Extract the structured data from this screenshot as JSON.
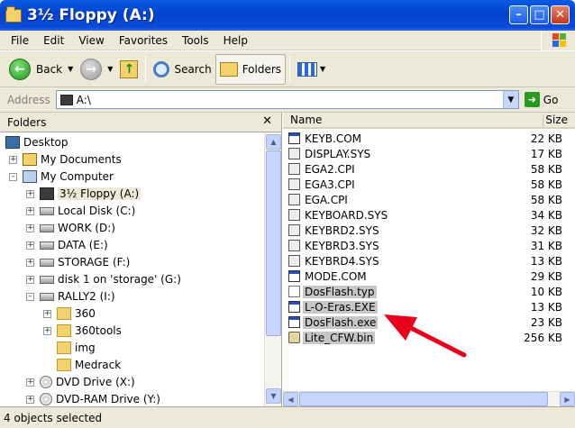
{
  "window": {
    "title": "3½ Floppy (A:)"
  },
  "menu": {
    "items": [
      "File",
      "Edit",
      "View",
      "Favorites",
      "Tools",
      "Help"
    ]
  },
  "toolbar": {
    "back_label": "Back",
    "search_label": "Search",
    "folders_label": "Folders"
  },
  "address": {
    "label": "Address",
    "value": "A:\\",
    "go_label": "Go"
  },
  "folders_pane": {
    "header": "Folders",
    "tree": [
      {
        "label": "Desktop",
        "icon": "desktop-icon"
      },
      {
        "label": "My Documents",
        "icon": "folder-icon"
      },
      {
        "label": "My Computer",
        "icon": "computer-icon"
      },
      {
        "label": "3½ Floppy (A:)",
        "icon": "floppy-icon"
      },
      {
        "label": "Local Disk (C:)",
        "icon": "drive-icon"
      },
      {
        "label": "WORK (D:)",
        "icon": "drive-icon"
      },
      {
        "label": "DATA (E:)",
        "icon": "drive-icon"
      },
      {
        "label": "STORAGE (F:)",
        "icon": "drive-icon"
      },
      {
        "label": "disk 1 on 'storage' (G:)",
        "icon": "network-drive-icon"
      },
      {
        "label": "RALLY2 (I:)",
        "icon": "drive-icon"
      },
      {
        "label": "360",
        "icon": "folder-icon"
      },
      {
        "label": "360tools",
        "icon": "folder-icon"
      },
      {
        "label": "img",
        "icon": "folder-icon"
      },
      {
        "label": "Medrack",
        "icon": "folder-icon"
      },
      {
        "label": "DVD Drive (X:)",
        "icon": "cd-icon"
      },
      {
        "label": "DVD-RAM Drive (Y:)",
        "icon": "cd-icon"
      }
    ]
  },
  "files": {
    "columns": {
      "name": "Name",
      "size": "Size"
    },
    "rows": [
      {
        "name": "KEYB.COM",
        "size": "22 KB",
        "type": "com"
      },
      {
        "name": "DISPLAY.SYS",
        "size": "17 KB",
        "type": "sys"
      },
      {
        "name": "EGA2.CPI",
        "size": "58 KB",
        "type": "cpi"
      },
      {
        "name": "EGA3.CPI",
        "size": "58 KB",
        "type": "cpi"
      },
      {
        "name": "EGA.CPI",
        "size": "58 KB",
        "type": "cpi"
      },
      {
        "name": "KEYBOARD.SYS",
        "size": "34 KB",
        "type": "sys"
      },
      {
        "name": "KEYBRD2.SYS",
        "size": "32 KB",
        "type": "sys"
      },
      {
        "name": "KEYBRD3.SYS",
        "size": "31 KB",
        "type": "sys"
      },
      {
        "name": "KEYBRD4.SYS",
        "size": "13 KB",
        "type": "sys"
      },
      {
        "name": "MODE.COM",
        "size": "29 KB",
        "type": "com"
      },
      {
        "name": "DosFlash.typ",
        "size": "10 KB",
        "type": "typ"
      },
      {
        "name": "L-O-Eras.EXE",
        "size": "13 KB",
        "type": "exe"
      },
      {
        "name": "DosFlash.exe",
        "size": "23 KB",
        "type": "exe"
      },
      {
        "name": "Lite_CFW.bin",
        "size": "256 KB",
        "type": "bin"
      }
    ]
  },
  "status": {
    "text": "4 objects selected"
  },
  "colors": {
    "title_blue": "#0342d0",
    "annotation_arrow": "#e8001c",
    "selection_gray": "#c7c7c7"
  }
}
